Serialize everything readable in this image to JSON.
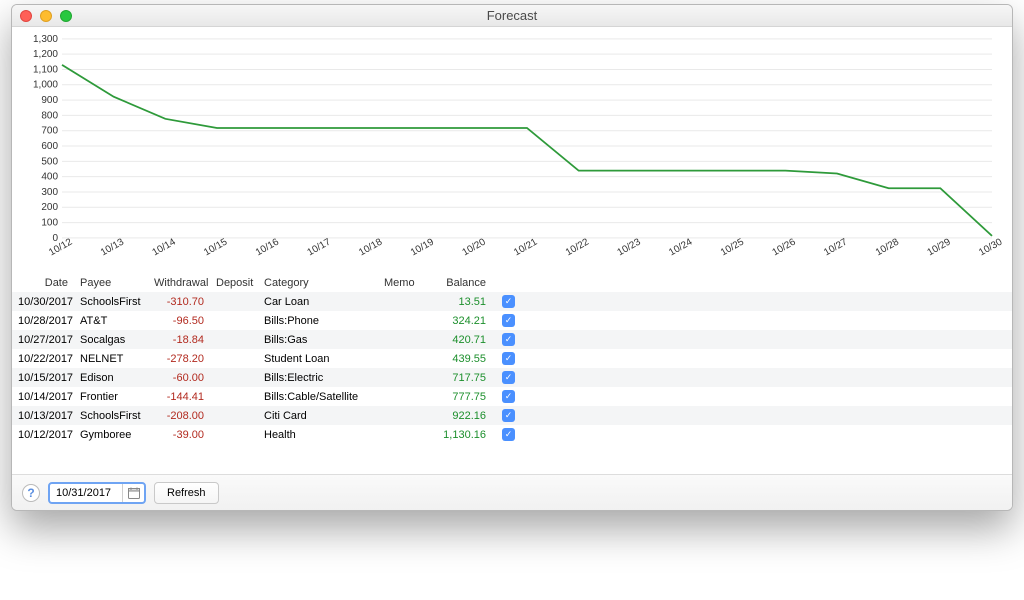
{
  "window": {
    "title": "Forecast"
  },
  "footer": {
    "date_value": "10/31/2017",
    "refresh_label": "Refresh"
  },
  "columns": {
    "date": "Date",
    "payee": "Payee",
    "withdrawal": "Withdrawal",
    "deposit": "Deposit",
    "category": "Category",
    "memo": "Memo",
    "balance": "Balance"
  },
  "rows": [
    {
      "date": "10/30/2017",
      "payee": "SchoolsFirst",
      "withdrawal": "-310.70",
      "deposit": "",
      "category": "Car Loan",
      "memo": "",
      "balance": "13.51"
    },
    {
      "date": "10/28/2017",
      "payee": "AT&T",
      "withdrawal": "-96.50",
      "deposit": "",
      "category": "Bills:Phone",
      "memo": "",
      "balance": "324.21"
    },
    {
      "date": "10/27/2017",
      "payee": "Socalgas",
      "withdrawal": "-18.84",
      "deposit": "",
      "category": "Bills:Gas",
      "memo": "",
      "balance": "420.71"
    },
    {
      "date": "10/22/2017",
      "payee": "NELNET",
      "withdrawal": "-278.20",
      "deposit": "",
      "category": "Student Loan",
      "memo": "",
      "balance": "439.55"
    },
    {
      "date": "10/15/2017",
      "payee": "Edison",
      "withdrawal": "-60.00",
      "deposit": "",
      "category": "Bills:Electric",
      "memo": "",
      "balance": "717.75"
    },
    {
      "date": "10/14/2017",
      "payee": "Frontier",
      "withdrawal": "-144.41",
      "deposit": "",
      "category": "Bills:Cable/Satellite",
      "memo": "",
      "balance": "777.75"
    },
    {
      "date": "10/13/2017",
      "payee": "SchoolsFirst",
      "withdrawal": "-208.00",
      "deposit": "",
      "category": "Citi Card",
      "memo": "",
      "balance": "922.16"
    },
    {
      "date": "10/12/2017",
      "payee": "Gymboree",
      "withdrawal": "-39.00",
      "deposit": "",
      "category": "Health",
      "memo": "",
      "balance": "1,130.16"
    }
  ],
  "chart_data": {
    "type": "line",
    "title": "",
    "xlabel": "",
    "ylabel": "",
    "ylim": [
      0,
      1300
    ],
    "y_ticks": [
      0,
      100,
      200,
      300,
      400,
      500,
      600,
      700,
      800,
      900,
      1000,
      1100,
      1200,
      1300
    ],
    "categories": [
      "10/12",
      "10/13",
      "10/14",
      "10/15",
      "10/16",
      "10/17",
      "10/18",
      "10/19",
      "10/20",
      "10/21",
      "10/22",
      "10/23",
      "10/24",
      "10/25",
      "10/26",
      "10/27",
      "10/28",
      "10/29",
      "10/30"
    ],
    "series": [
      {
        "name": "Balance",
        "color": "#2e9a3a",
        "values": [
          1130.16,
          922.16,
          777.75,
          717.75,
          717.75,
          717.75,
          717.75,
          717.75,
          717.75,
          717.75,
          439.55,
          439.55,
          439.55,
          439.55,
          439.55,
          420.71,
          324.21,
          324.21,
          13.51
        ]
      }
    ]
  }
}
